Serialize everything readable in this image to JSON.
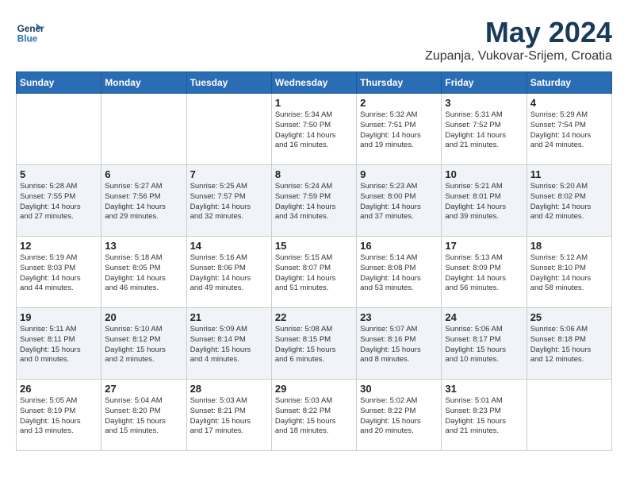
{
  "header": {
    "logo_line1": "General",
    "logo_line2": "Blue",
    "month": "May 2024",
    "location": "Zupanja, Vukovar-Srijem, Croatia"
  },
  "days_of_week": [
    "Sunday",
    "Monday",
    "Tuesday",
    "Wednesday",
    "Thursday",
    "Friday",
    "Saturday"
  ],
  "weeks": [
    [
      {
        "day": "",
        "detail": ""
      },
      {
        "day": "",
        "detail": ""
      },
      {
        "day": "",
        "detail": ""
      },
      {
        "day": "1",
        "detail": "Sunrise: 5:34 AM\nSunset: 7:50 PM\nDaylight: 14 hours\nand 16 minutes."
      },
      {
        "day": "2",
        "detail": "Sunrise: 5:32 AM\nSunset: 7:51 PM\nDaylight: 14 hours\nand 19 minutes."
      },
      {
        "day": "3",
        "detail": "Sunrise: 5:31 AM\nSunset: 7:52 PM\nDaylight: 14 hours\nand 21 minutes."
      },
      {
        "day": "4",
        "detail": "Sunrise: 5:29 AM\nSunset: 7:54 PM\nDaylight: 14 hours\nand 24 minutes."
      }
    ],
    [
      {
        "day": "5",
        "detail": "Sunrise: 5:28 AM\nSunset: 7:55 PM\nDaylight: 14 hours\nand 27 minutes."
      },
      {
        "day": "6",
        "detail": "Sunrise: 5:27 AM\nSunset: 7:56 PM\nDaylight: 14 hours\nand 29 minutes."
      },
      {
        "day": "7",
        "detail": "Sunrise: 5:25 AM\nSunset: 7:57 PM\nDaylight: 14 hours\nand 32 minutes."
      },
      {
        "day": "8",
        "detail": "Sunrise: 5:24 AM\nSunset: 7:59 PM\nDaylight: 14 hours\nand 34 minutes."
      },
      {
        "day": "9",
        "detail": "Sunrise: 5:23 AM\nSunset: 8:00 PM\nDaylight: 14 hours\nand 37 minutes."
      },
      {
        "day": "10",
        "detail": "Sunrise: 5:21 AM\nSunset: 8:01 PM\nDaylight: 14 hours\nand 39 minutes."
      },
      {
        "day": "11",
        "detail": "Sunrise: 5:20 AM\nSunset: 8:02 PM\nDaylight: 14 hours\nand 42 minutes."
      }
    ],
    [
      {
        "day": "12",
        "detail": "Sunrise: 5:19 AM\nSunset: 8:03 PM\nDaylight: 14 hours\nand 44 minutes."
      },
      {
        "day": "13",
        "detail": "Sunrise: 5:18 AM\nSunset: 8:05 PM\nDaylight: 14 hours\nand 46 minutes."
      },
      {
        "day": "14",
        "detail": "Sunrise: 5:16 AM\nSunset: 8:06 PM\nDaylight: 14 hours\nand 49 minutes."
      },
      {
        "day": "15",
        "detail": "Sunrise: 5:15 AM\nSunset: 8:07 PM\nDaylight: 14 hours\nand 51 minutes."
      },
      {
        "day": "16",
        "detail": "Sunrise: 5:14 AM\nSunset: 8:08 PM\nDaylight: 14 hours\nand 53 minutes."
      },
      {
        "day": "17",
        "detail": "Sunrise: 5:13 AM\nSunset: 8:09 PM\nDaylight: 14 hours\nand 56 minutes."
      },
      {
        "day": "18",
        "detail": "Sunrise: 5:12 AM\nSunset: 8:10 PM\nDaylight: 14 hours\nand 58 minutes."
      }
    ],
    [
      {
        "day": "19",
        "detail": "Sunrise: 5:11 AM\nSunset: 8:11 PM\nDaylight: 15 hours\nand 0 minutes."
      },
      {
        "day": "20",
        "detail": "Sunrise: 5:10 AM\nSunset: 8:12 PM\nDaylight: 15 hours\nand 2 minutes."
      },
      {
        "day": "21",
        "detail": "Sunrise: 5:09 AM\nSunset: 8:14 PM\nDaylight: 15 hours\nand 4 minutes."
      },
      {
        "day": "22",
        "detail": "Sunrise: 5:08 AM\nSunset: 8:15 PM\nDaylight: 15 hours\nand 6 minutes."
      },
      {
        "day": "23",
        "detail": "Sunrise: 5:07 AM\nSunset: 8:16 PM\nDaylight: 15 hours\nand 8 minutes."
      },
      {
        "day": "24",
        "detail": "Sunrise: 5:06 AM\nSunset: 8:17 PM\nDaylight: 15 hours\nand 10 minutes."
      },
      {
        "day": "25",
        "detail": "Sunrise: 5:06 AM\nSunset: 8:18 PM\nDaylight: 15 hours\nand 12 minutes."
      }
    ],
    [
      {
        "day": "26",
        "detail": "Sunrise: 5:05 AM\nSunset: 8:19 PM\nDaylight: 15 hours\nand 13 minutes."
      },
      {
        "day": "27",
        "detail": "Sunrise: 5:04 AM\nSunset: 8:20 PM\nDaylight: 15 hours\nand 15 minutes."
      },
      {
        "day": "28",
        "detail": "Sunrise: 5:03 AM\nSunset: 8:21 PM\nDaylight: 15 hours\nand 17 minutes."
      },
      {
        "day": "29",
        "detail": "Sunrise: 5:03 AM\nSunset: 8:22 PM\nDaylight: 15 hours\nand 18 minutes."
      },
      {
        "day": "30",
        "detail": "Sunrise: 5:02 AM\nSunset: 8:22 PM\nDaylight: 15 hours\nand 20 minutes."
      },
      {
        "day": "31",
        "detail": "Sunrise: 5:01 AM\nSunset: 8:23 PM\nDaylight: 15 hours\nand 21 minutes."
      },
      {
        "day": "",
        "detail": ""
      }
    ]
  ]
}
